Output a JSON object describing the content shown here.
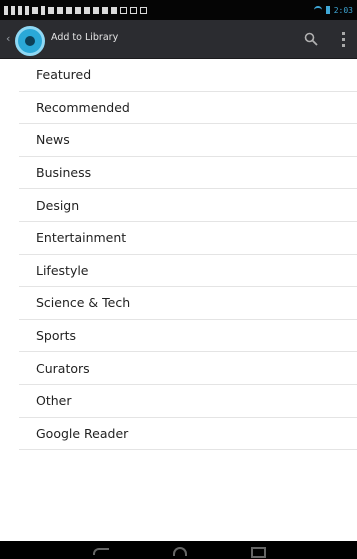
{
  "status_bar": {
    "time": "2:03",
    "notification_icons": [
      "usb-icon",
      "download-icon",
      "download-icon",
      "download-icon",
      "sd-card-icon",
      "dollar-icon",
      "image-icon",
      "warning-icon",
      "calendar-icon",
      "mail-icon",
      "mail-icon",
      "mail-icon",
      "mail-icon",
      "mail-icon",
      "box-icon",
      "box-icon",
      "box-icon"
    ]
  },
  "action_bar": {
    "title": "Add to Library",
    "icons": [
      "app-logo-icon",
      "search-icon",
      "overflow-menu-icon"
    ]
  },
  "categories": [
    "Featured",
    "Recommended",
    "News",
    "Business",
    "Design",
    "Entertainment",
    "Lifestyle",
    "Science & Tech",
    "Sports",
    "Curators",
    "Other",
    "Google Reader"
  ],
  "nav_bar": {
    "icons": [
      "back-icon",
      "home-icon",
      "recent-apps-icon"
    ]
  },
  "colors": {
    "action_bar_bg": "#2b2c30",
    "accent": "#2aa8d8",
    "status_accent": "#3fa7d6"
  }
}
